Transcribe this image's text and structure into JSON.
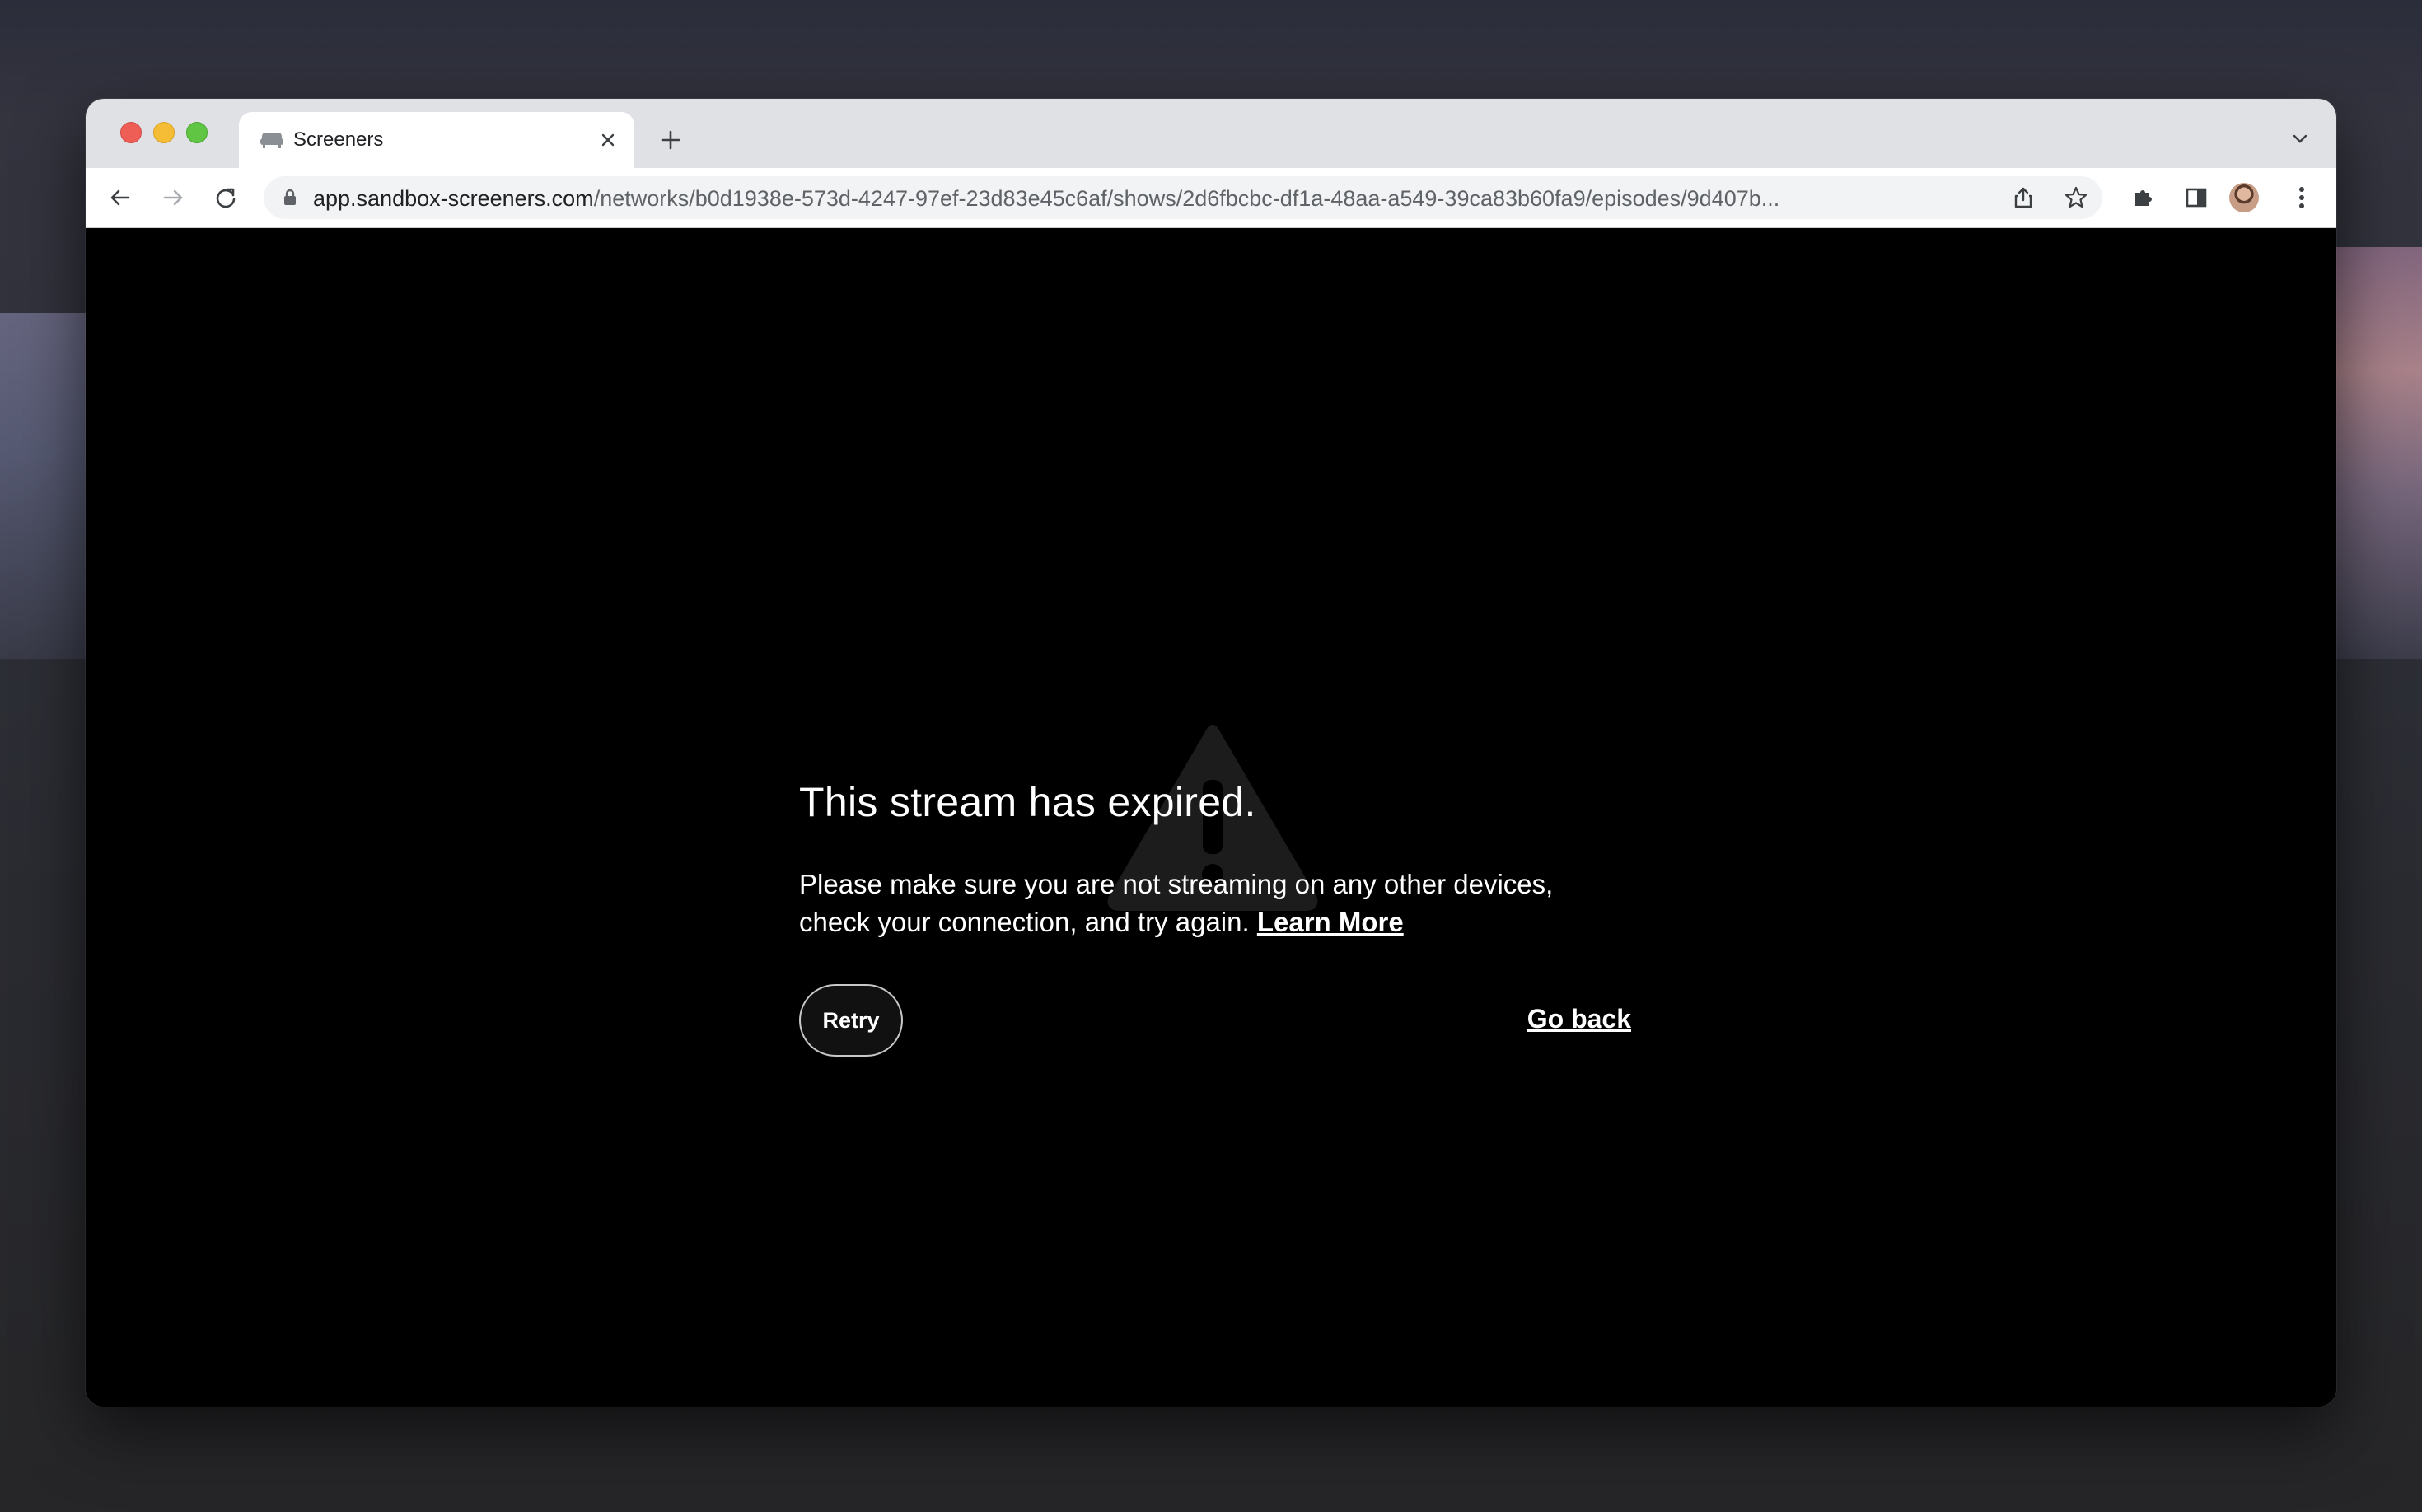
{
  "browser": {
    "tab": {
      "title": "Screeners",
      "icon": "couch-icon"
    },
    "address_bar": {
      "host": "app.sandbox-screeners.com",
      "path": "/networks/b0d1938e-573d-4247-97ef-23d83e45c6af/shows/2d6fbcbc-df1a-48aa-a549-39ca83b60fa9/episodes/9d407b..."
    }
  },
  "error": {
    "title": "This stream has expired.",
    "message": "Please make sure you are not streaming on any other devices, check your connection, and try again.",
    "learn_more": "Learn More",
    "retry_label": "Retry",
    "go_back_label": "Go back"
  },
  "colors": {
    "player_background": "#000000",
    "text": "#ffffff",
    "tab_bar": "#dfe1e5"
  }
}
